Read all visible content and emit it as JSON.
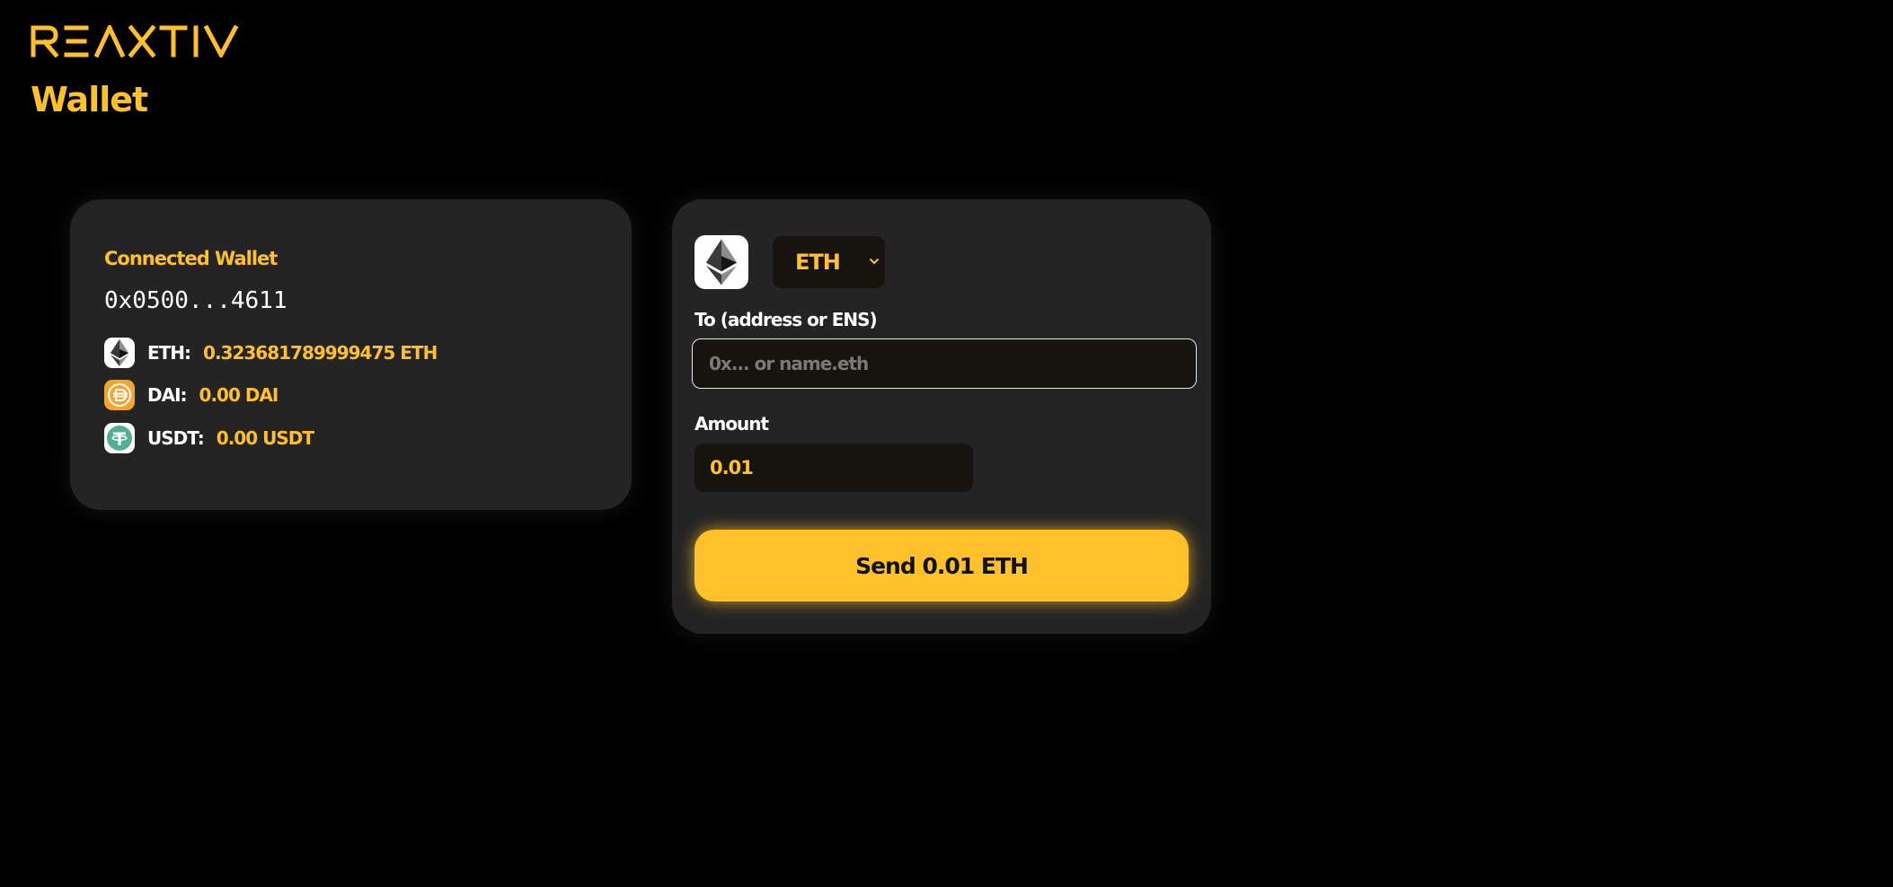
{
  "header": {
    "logo_text": "REAXTIV",
    "title": "Wallet"
  },
  "wallet": {
    "connected_label": "Connected Wallet",
    "address": "0x0500...4611",
    "balances": [
      {
        "symbol_label": "ETH:",
        "value": "0.323681789999475 ETH",
        "icon": "ethereum-icon"
      },
      {
        "symbol_label": "DAI:",
        "value": "0.00 DAI",
        "icon": "dai-icon"
      },
      {
        "symbol_label": "USDT:",
        "value": "0.00 USDT",
        "icon": "tether-icon"
      }
    ]
  },
  "send": {
    "selected_token": "ETH",
    "selected_token_icon": "ethereum-icon",
    "to_label": "To (address or ENS)",
    "to_value": "",
    "to_placeholder": "0x... or name.eth",
    "amount_label": "Amount",
    "amount_value": "0.01",
    "button_label": "Send 0.01 ETH"
  },
  "colors": {
    "background": "#000000",
    "card": "#242424",
    "accent": "#ffc02a",
    "input_bg": "#171410",
    "text": "#ffffff",
    "dai": "#f4a52f",
    "tether": "#50af95"
  }
}
